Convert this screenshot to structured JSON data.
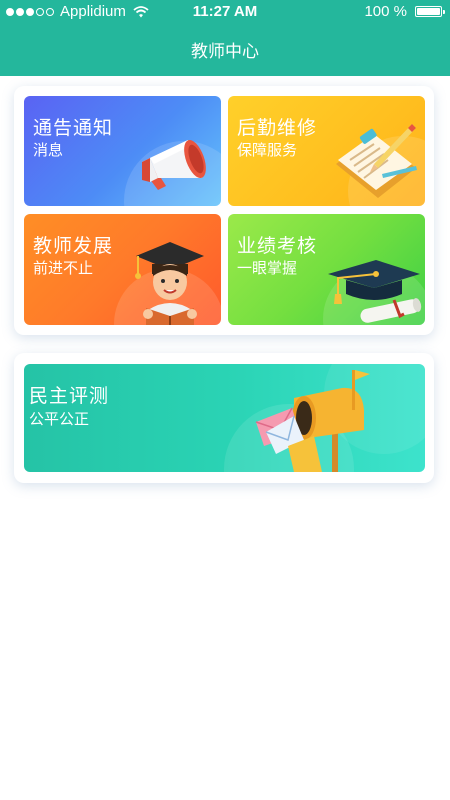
{
  "status_bar": {
    "carrier": "Applidium",
    "time": "11:27 AM",
    "battery": "100 %",
    "signal_dots_filled": 3,
    "signal_dots_total": 5
  },
  "nav": {
    "title": "教师中心"
  },
  "cards": [
    {
      "title": "通告通知",
      "subtitle": "消息",
      "icon": "megaphone-icon",
      "color": "#4d8cf6"
    },
    {
      "title": "后勤维修",
      "subtitle": "保障服务",
      "icon": "clipboard-icon",
      "color": "#ffbf1f"
    },
    {
      "title": "教师发展",
      "subtitle": "前进不止",
      "icon": "teacher-icon",
      "color": "#ff7a2a"
    },
    {
      "title": "业绩考核",
      "subtitle": "一眼掌握",
      "icon": "graduation-cap-icon",
      "color": "#74df40"
    },
    {
      "title": "民主评测",
      "subtitle": "公平公正",
      "icon": "mailbox-icon",
      "color": "#2ad3b4"
    }
  ],
  "colors": {
    "primary": "#24b79c"
  }
}
